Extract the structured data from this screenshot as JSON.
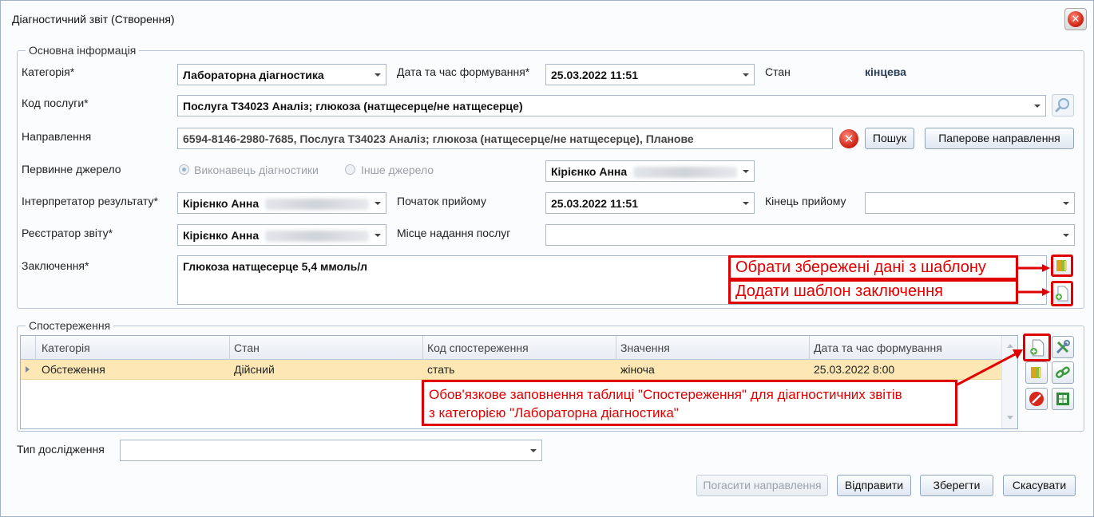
{
  "window": {
    "title": "Діагностичний звіт (Створення)"
  },
  "main_info": {
    "legend": "Основна інформація",
    "category": {
      "label": "Категорія*",
      "value": "Лабораторна діагностика"
    },
    "created_at": {
      "label": "Дата та час формування*",
      "value": "25.03.2022 11:51"
    },
    "state": {
      "label": "Стан",
      "value": "кінцева"
    },
    "service_code": {
      "label": "Код послуги*",
      "value": "Послуга Т34023 Аналіз; глюкоза (натщесерце/не натщесерце)"
    },
    "referral": {
      "label": "Направлення",
      "value": "6594-8146-2980-7685, Послуга Т34023 Аналіз; глюкоза (натщесерце/не натщесерце), Планове",
      "search_label": "Пошук",
      "paper_label": "Паперове направлення"
    },
    "primary_source": {
      "label": "Первинне джерело",
      "option1": "Виконавець діагностики",
      "option2": "Інше джерело",
      "performer": "Кірієнко Анна"
    },
    "interpreter": {
      "label": "Інтерпретатор результату*",
      "value": "Кірієнко Анна"
    },
    "appointment_start": {
      "label": "Початок прийому",
      "value": "25.03.2022 11:51"
    },
    "appointment_end": {
      "label": "Кінець прийому",
      "value": ""
    },
    "registrar": {
      "label": "Реєстратор звіту*",
      "value": "Кірієнко Анна"
    },
    "service_place": {
      "label": "Місце надання послуг",
      "value": ""
    },
    "conclusion": {
      "label": "Заключення*",
      "value": "Глюкоза натщесерце 5,4 ммоль/л"
    }
  },
  "annotations": {
    "template_select": "Обрати збережені дані з шаблону",
    "template_add": "Додати шаблон заключення",
    "observations_line1": "Обов'язкове заповнення таблиці \"Спостереження\" для діагностичних звітів",
    "observations_line2": "з категорією \"Лабораторна діагностика\""
  },
  "observations": {
    "legend": "Спостереження",
    "columns": [
      "Категорія",
      "Стан",
      "Код спостереження",
      "Значення",
      "Дата та час формування"
    ],
    "rows": [
      [
        "Обстеження",
        "Дійсний",
        "стать",
        "жіноча",
        "25.03.2022 8:00"
      ]
    ]
  },
  "study_type": {
    "label": "Тип дослідження",
    "value": ""
  },
  "footer": {
    "cancel_referral": "Погасити направлення",
    "send": "Відправити",
    "save": "Зберегти",
    "cancel": "Скасувати"
  },
  "colors": {
    "annotation_red": "#e00000",
    "row_highlight": "#fde8b5"
  }
}
